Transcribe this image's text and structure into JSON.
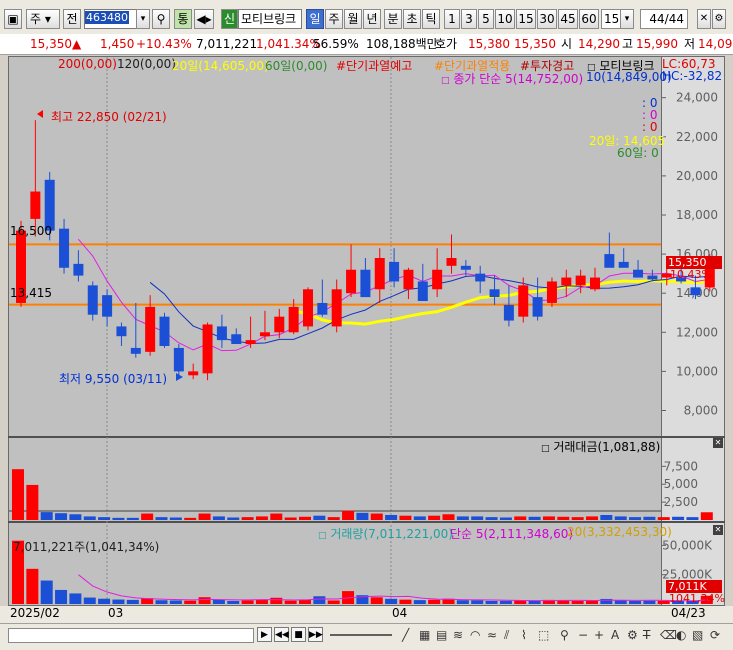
{
  "toolbar": {
    "market": "주",
    "prev_label": "전",
    "code": "463480",
    "tong_label": "통",
    "sin_label": "신",
    "stock_name": "모티브링크",
    "periods": [
      "일",
      "주",
      "월",
      "년",
      "분",
      "초",
      "틱"
    ],
    "intervals": [
      "1",
      "3",
      "5",
      "10",
      "15",
      "30",
      "45",
      "60"
    ],
    "interval_value": "15",
    "page_count": "44/44"
  },
  "quote": {
    "price": "15,350",
    "change": "1,450",
    "change_pct": "+10.43%",
    "volume": "7,011,221",
    "volume_ratio": "1,041.34%",
    "turnover_pct": "56.59%",
    "amount": "108,188백만",
    "ask_label": "호가",
    "ask_value": "15,380",
    "bid_value": "15,350",
    "open_label": "시",
    "open": "14,290",
    "high_label": "고",
    "high": "15,990",
    "low_label": "저",
    "low": "14,09"
  },
  "legends": {
    "ma200": "200(0,00)",
    "ma120": "120(0,00)",
    "ma20": "20일(14,605,00)",
    "ma60": "60일(0,00)",
    "warn1": "#단기과열예고",
    "warn2": "#단기과열적용",
    "warn3": "#투자경고",
    "name_tag": "모티브링크",
    "ma5": "종가 단순 5(14,752,00)",
    "ma10": "10(14,849,00)",
    "lc": "LC:60,73",
    "hc": "HC:-32,82",
    "right_vals": [
      ": 0",
      ": 0",
      ": 0"
    ],
    "ma20_right": "20일: 14,605",
    "ma60_right": "60일: 0",
    "amount_panel": "거래대금(1,081,88)",
    "vol_panel": "거래량(7,011,221,00)",
    "vol_ma5": "단순 5(2,111,348,60)",
    "vol_ma20": "20(3,332,453,30)",
    "vol_annotation": "7,011,221주(1,041,34%)"
  },
  "annotations": {
    "high": "최고 22,850 (02/21)",
    "low": "최저 9,550 (03/11)",
    "line_16500": "16,500",
    "line_13415": "13,415",
    "price_tag": "15,350",
    "pct_tag": "10,43%",
    "vol_tag": "7,011K",
    "vol_pct_tag": "1041,34%"
  },
  "xaxis": {
    "labels": [
      "2025/02",
      "03",
      "04"
    ],
    "right_date": "04/23"
  },
  "colors": {
    "up": "#ff0000",
    "down": "#1a4fd6",
    "ma5": "#e020e0",
    "ma10": "#1030c0",
    "ma20": "#ffff00",
    "hline": "#ff8000"
  },
  "chart_data": [
    {
      "type": "candlestick",
      "title": "모티브링크",
      "y_ticks": [
        "24,000",
        "22,000",
        "20,000",
        "18,000",
        "16,000",
        "14,000",
        "12,000",
        "10,000",
        "8,000"
      ],
      "ylim": [
        6900,
        24700
      ],
      "hlines": [
        16500,
        13415
      ],
      "ohlc": [
        [
          13500,
          17700,
          13300,
          17200
        ],
        [
          17800,
          22850,
          16900,
          19200
        ],
        [
          19800,
          20200,
          16700,
          17200
        ],
        [
          17300,
          17800,
          15000,
          15300
        ],
        [
          15500,
          16200,
          14600,
          14900
        ],
        [
          14400,
          14600,
          12600,
          12900
        ],
        [
          13900,
          14200,
          12300,
          12800
        ],
        [
          12300,
          12500,
          11300,
          11800
        ],
        [
          11200,
          13500,
          10700,
          10900
        ],
        [
          11000,
          13900,
          10800,
          13300
        ],
        [
          12800,
          13000,
          11200,
          11300
        ],
        [
          11200,
          11400,
          9800,
          10000
        ],
        [
          9800,
          10400,
          9600,
          10000
        ],
        [
          9900,
          12500,
          9550,
          12400
        ],
        [
          12300,
          12900,
          11200,
          11600
        ],
        [
          11900,
          12200,
          11400,
          11400
        ],
        [
          11400,
          12800,
          11200,
          11600
        ],
        [
          11800,
          13100,
          11600,
          12000
        ],
        [
          12000,
          13200,
          11700,
          12800
        ],
        [
          12000,
          13700,
          11900,
          13300
        ],
        [
          12300,
          14300,
          12100,
          14200
        ],
        [
          13500,
          14700,
          12800,
          12900
        ],
        [
          12300,
          14700,
          12000,
          14200
        ],
        [
          14000,
          16500,
          13800,
          15200
        ],
        [
          15200,
          15800,
          14500,
          13800
        ],
        [
          14200,
          16300,
          13500,
          15800
        ],
        [
          15600,
          16300,
          14300,
          14600
        ],
        [
          14200,
          15300,
          13700,
          15200
        ],
        [
          14600,
          15500,
          14200,
          13600
        ],
        [
          14200,
          16300,
          13800,
          15200
        ],
        [
          15400,
          17000,
          15000,
          15800
        ],
        [
          15400,
          15700,
          14900,
          15200
        ],
        [
          15000,
          15400,
          14000,
          14600
        ],
        [
          14200,
          14900,
          13400,
          13800
        ],
        [
          13400,
          14400,
          12300,
          12600
        ],
        [
          12800,
          14800,
          12500,
          14400
        ],
        [
          13800,
          14800,
          12600,
          12800
        ],
        [
          13500,
          14800,
          13300,
          14600
        ],
        [
          14400,
          15200,
          13800,
          14800
        ],
        [
          14400,
          15200,
          14000,
          14900
        ],
        [
          14200,
          15300,
          14100,
          14800
        ],
        [
          16000,
          17100,
          15700,
          15300
        ],
        [
          15600,
          16300,
          15400,
          15300
        ],
        [
          15200,
          15700,
          14900,
          14800
        ],
        [
          14900,
          15200,
          14600,
          14700
        ],
        [
          14800,
          15300,
          14400,
          15000
        ],
        [
          14800,
          15400,
          14500,
          14600
        ],
        [
          14300,
          14900,
          13700,
          13900
        ],
        [
          14290,
          15990,
          14090,
          15350
        ]
      ],
      "ma5_end": 14752,
      "ma10_end": 14849,
      "ma20_end": 14605
    },
    {
      "type": "bar",
      "title": "거래대금",
      "y_ticks": [
        "7,500",
        "5,000",
        "2,500"
      ],
      "ylim": [
        0,
        9500
      ],
      "values": [
        7100,
        4900,
        1100,
        950,
        800,
        500,
        400,
        300,
        300,
        900,
        400,
        350,
        300,
        900,
        500,
        350,
        400,
        500,
        900,
        350,
        450,
        600,
        400,
        1300,
        1000,
        900,
        700,
        600,
        500,
        600,
        800,
        500,
        500,
        400,
        350,
        500,
        450,
        500,
        450,
        400,
        500,
        700,
        500,
        400,
        450,
        400,
        450,
        400,
        1081
      ]
    },
    {
      "type": "bar",
      "title": "거래량",
      "y_ticks": [
        "50,000K",
        "25,000K"
      ],
      "ylim": [
        0,
        58000
      ],
      "values": [
        54000,
        30000,
        20000,
        12000,
        9000,
        5500,
        4500,
        3800,
        3500,
        5000,
        3200,
        3000,
        2800,
        5800,
        3600,
        2600,
        3000,
        3400,
        5300,
        2800,
        3600,
        6600,
        3000,
        11000,
        7500,
        5700,
        4400,
        3700,
        3300,
        3600,
        4500,
        3200,
        3100,
        2600,
        2700,
        3300,
        2900,
        3500,
        3000,
        2600,
        3100,
        4300,
        3000,
        2600,
        2800,
        2700,
        2900,
        2700,
        7011
      ]
    }
  ]
}
